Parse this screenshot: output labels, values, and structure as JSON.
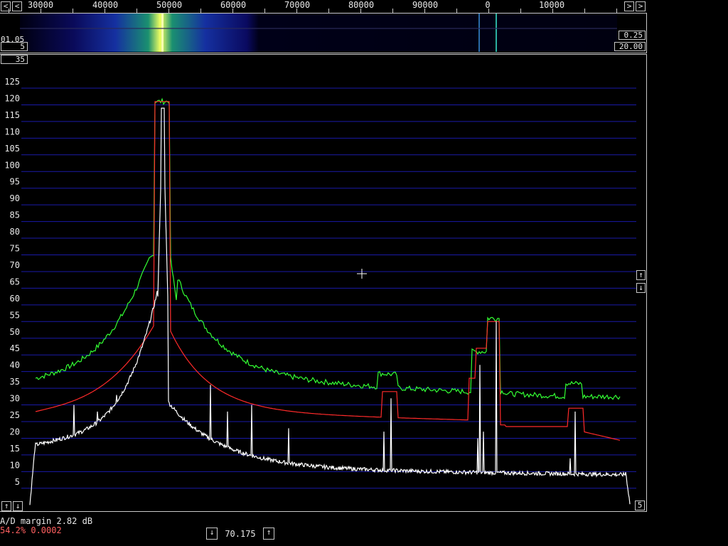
{
  "freq_scale": {
    "labels": [
      "30000",
      "40000",
      "50000",
      "60000",
      "70000",
      "80000",
      "90000",
      "0",
      "10000"
    ],
    "left_arrow": "<",
    "right_arrow": ">"
  },
  "waterfall": {
    "left_top_label": "01.05",
    "left_value": "5",
    "right_value1": "0.25",
    "right_value2": "20.00",
    "below_left_value": "35"
  },
  "spectrum": {
    "y_ticks": [
      "125",
      "120",
      "115",
      "110",
      "105",
      "100",
      "95",
      "90",
      "85",
      "80",
      "75",
      "70",
      "65",
      "60",
      "55",
      "50",
      "45",
      "40",
      "35",
      "30",
      "25",
      "20",
      "15",
      "10",
      "5"
    ],
    "grid_color": "#1a1aa8",
    "series_colors": {
      "white": "#ffffff",
      "red": "#ff2a2a",
      "green": "#33ff33"
    },
    "right_up_icon": "arrow-up-icon",
    "right_down_icon": "arrow-down-icon",
    "bottom_right_value": "5"
  },
  "status": {
    "ad_margin": "A/D margin 2.82 dB",
    "stats": "54.2% 0.0002"
  },
  "footer": {
    "value": "70.175"
  }
}
